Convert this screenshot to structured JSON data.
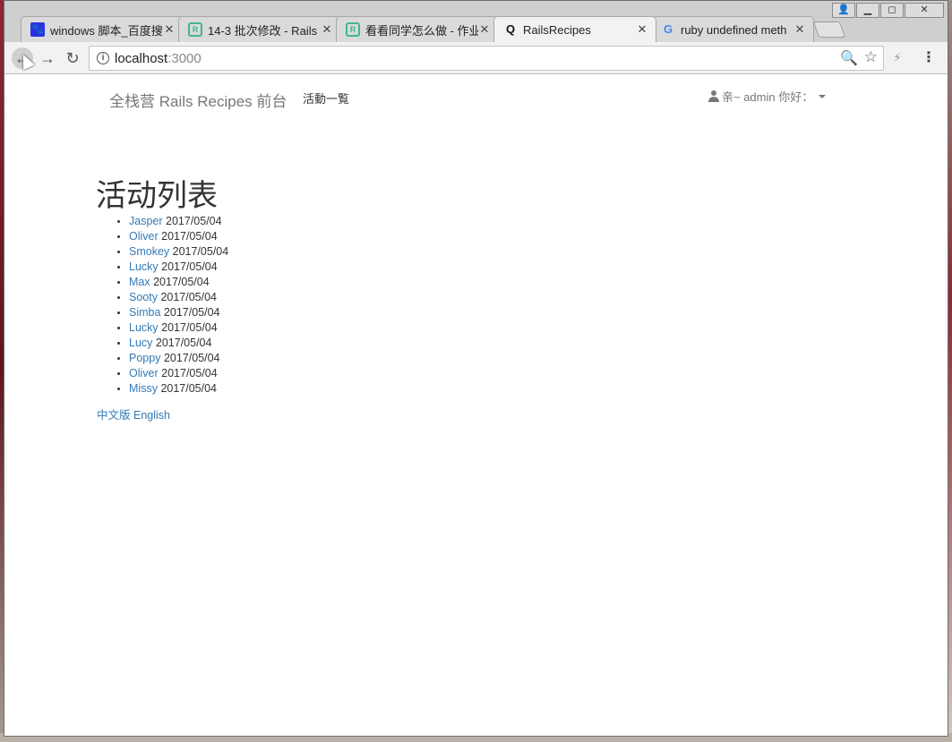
{
  "browser": {
    "tabs": [
      {
        "title": "windows 脚本_百度搜索",
        "icon": "baidu-icon",
        "active": false
      },
      {
        "title": "14-3 批次修改 - Rails",
        "icon": "rails-icon",
        "active": false
      },
      {
        "title": "看看同学怎么做 - 作业",
        "icon": "rails-icon",
        "active": false
      },
      {
        "title": "RailsRecipes",
        "icon": "q-icon",
        "active": true
      },
      {
        "title": "ruby undefined meth",
        "icon": "google-icon",
        "active": false
      }
    ],
    "close_glyph": "✕",
    "window_controls": {
      "user": "👤",
      "minimize": "▁",
      "maximize": "◻",
      "close": "✕"
    },
    "nav": {
      "back": "←",
      "forward": "→",
      "reload": "↻"
    },
    "url_host": "localhost",
    "url_port": ":3000",
    "zoom_glyph": "🔍",
    "star_glyph": "☆",
    "extension_glyph": "⚡",
    "menu_glyph": "⋮"
  },
  "site": {
    "brand": "全栈营 Rails Recipes 前台",
    "nav_link": "活動一覧",
    "greeting": "亲~ admin 你好："
  },
  "page": {
    "heading": "活动列表",
    "events": [
      {
        "name": "Jasper",
        "date": "2017/05/04"
      },
      {
        "name": "Oliver",
        "date": "2017/05/04"
      },
      {
        "name": "Smokey",
        "date": "2017/05/04"
      },
      {
        "name": "Lucky",
        "date": "2017/05/04"
      },
      {
        "name": "Max",
        "date": "2017/05/04"
      },
      {
        "name": "Sooty",
        "date": "2017/05/04"
      },
      {
        "name": "Simba",
        "date": "2017/05/04"
      },
      {
        "name": "Lucky",
        "date": "2017/05/04"
      },
      {
        "name": "Lucy",
        "date": "2017/05/04"
      },
      {
        "name": "Poppy",
        "date": "2017/05/04"
      },
      {
        "name": "Oliver",
        "date": "2017/05/04"
      },
      {
        "name": "Missy",
        "date": "2017/05/04"
      }
    ],
    "lang_zh": "中文版",
    "lang_en": "English"
  },
  "colors": {
    "link": "#337ab7",
    "brand": "#777777",
    "heading": "#333333"
  }
}
